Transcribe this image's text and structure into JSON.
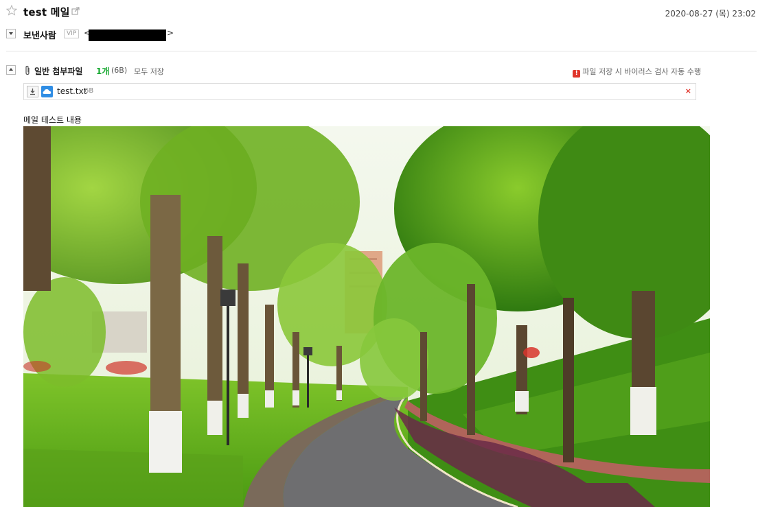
{
  "mail": {
    "subject": "test 메일",
    "date": "2020-08-27 (목) 23:02"
  },
  "sender": {
    "label": "보낸사람",
    "vip": "VIP",
    "open_bracket": "<",
    "close_bracket": ">"
  },
  "attachments": {
    "title": "일반 첨부파일",
    "count": "1개",
    "total_size": "(6B)",
    "save_all": "모두 저장",
    "virus_note": "파일 저장 시 바이러스 검사 자동 수행",
    "files": [
      {
        "name": "test.txt",
        "size": "6B",
        "remove": "×"
      }
    ]
  },
  "content": {
    "text": "메일 테스트 내용"
  },
  "icons": {
    "star": "star-icon",
    "popout": "popout-icon",
    "clip": "paperclip-icon",
    "warning": "warning-icon",
    "download": "download-icon",
    "cloud": "cloud-icon"
  },
  "colors": {
    "count_green": "#16a82f",
    "warning_red": "#e0352b",
    "cloud_blue": "#2f8de4"
  }
}
